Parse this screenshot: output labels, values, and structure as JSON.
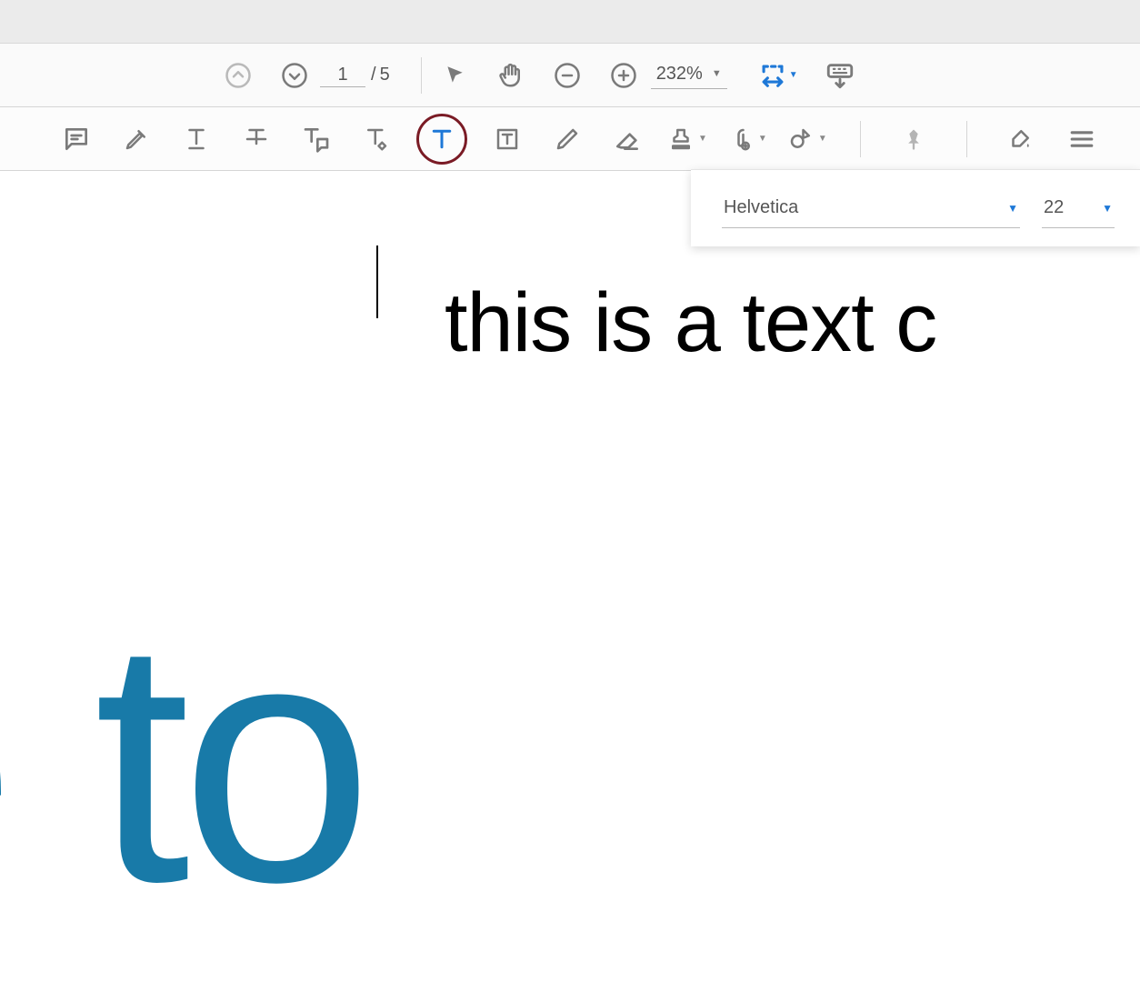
{
  "pager": {
    "current": "1",
    "separator": "/",
    "total": "5"
  },
  "zoom": {
    "value": "232%"
  },
  "font_popup": {
    "font": "Helvetica",
    "size": "22"
  },
  "document": {
    "typed_text": "this is a text c",
    "background_text": "me to"
  }
}
